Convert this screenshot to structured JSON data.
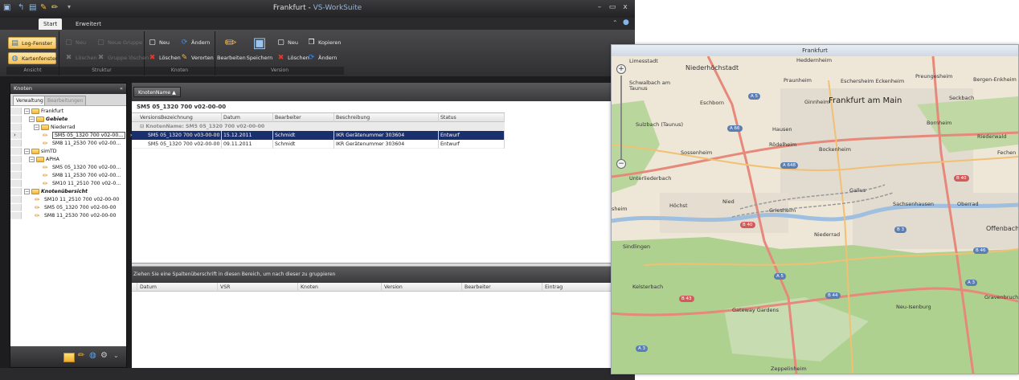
{
  "titlebar": {
    "title_city": "Frankfurt",
    "title_sep": " - ",
    "title_suite": "VS-WorkSuite",
    "min": "–",
    "max": "▭",
    "close": "x"
  },
  "tabs": [
    {
      "label": "Start"
    },
    {
      "label": "Erweitert"
    }
  ],
  "ribbon": {
    "ansicht": {
      "label": "Ansicht",
      "log": "Log-Fenster",
      "karten": "Kartenfenster"
    },
    "struktur": {
      "label": "Struktur",
      "neu": "Neu",
      "neue_gruppe": "Neue Gruppe",
      "loeschen": "Löschen",
      "gruppe_loeschen": "Gruppe löschen"
    },
    "knoten": {
      "label": "Knoten",
      "neu": "Neu",
      "aendern": "Ändern",
      "loeschen": "Löschen",
      "verorten": "Verorten"
    },
    "version": {
      "label": "Version",
      "bearbeiten": "Bearbeiten",
      "speichern": "Speichern",
      "neu": "Neu",
      "loeschen": "Löschen",
      "kopieren": "Kopieren",
      "aendern": "Ändern"
    }
  },
  "leftpanel": {
    "title": "Knoten",
    "collapse": "«",
    "tabs": [
      {
        "label": "Verwaltung"
      },
      {
        "label": "Bearbeitungen"
      }
    ],
    "tree": [
      {
        "label": "Frankfurt"
      },
      {
        "label": "Gebiete"
      },
      {
        "label": "Niederrad"
      },
      {
        "label": "SM5 05_1320 700 v02-00..."
      },
      {
        "label": "SM8 11_2530 700 v02-00..."
      },
      {
        "label": "simTD"
      },
      {
        "label": "APHA"
      },
      {
        "label": "SM5 05_1320 700 v02-00..."
      },
      {
        "label": "SM8 11_2530 700 v02-00..."
      },
      {
        "label": "SM10 11_2510 700 v02-0..."
      },
      {
        "label": "Knotenübersicht"
      },
      {
        "label": "SM10 11_2510 700 v02-00-00"
      },
      {
        "label": "SM5 05_1320 700 v02-00-00"
      },
      {
        "label": "SM8 11_2530 700 v02-00-00"
      }
    ]
  },
  "maingrid": {
    "group_pill": "KnotenName",
    "title": "SM5 05_1320 700 v02-00-00",
    "columns": [
      "VersionsBezeichnung",
      "Datum",
      "Bearbeiter",
      "Beschreibung",
      "Status"
    ],
    "group_row": "KnotenName: SM5 05_1320 700 v02-00-00",
    "rows": [
      {
        "version": "SM5 05_1320 700 v03-00-00",
        "datum": "15.12.2011",
        "bearbeiter": "Schmidt",
        "beschreibung": "IKR Gerätenummer 303604",
        "status": "Entwurf"
      },
      {
        "version": "SM5 05_1320 700 v02-00-00",
        "datum": "09.11.2011",
        "bearbeiter": "Schmidt",
        "beschreibung": "IKR Gerätenummer 303604",
        "status": "Entwurf"
      }
    ]
  },
  "lowergrid": {
    "hint": "Ziehen Sie eine Spaltenüberschrift in diesen Bereich, um nach dieser zu gruppieren",
    "columns": [
      "Datum",
      "VSR",
      "Knoten",
      "Version",
      "Bearbeiter",
      "Eintrag"
    ]
  },
  "map": {
    "title": "Frankfurt",
    "zoom_in": "+",
    "zoom_out": "−",
    "labels": {
      "limesstadt": "Limesstadt",
      "niederhoechstadt": "Niederhöchstadt",
      "heddernheim": "Heddernheim",
      "schwalbach": "Schwalbach am Taunus",
      "praunheim": "Praunheim",
      "eschersheim": "Eschersheim Eckenheim",
      "preungesheim": "Preungesheim",
      "bergen": "Bergen-Enkheim",
      "eschborn": "Eschborn",
      "ginnheim": "Ginnheim",
      "frankfurt": "Frankfurt am Main",
      "seckbach": "Seckbach",
      "sulzbach": "Sulzbach (Taunus)",
      "hausen": "Hausen",
      "bornheim": "Bornheim",
      "riederwald": "Riederwald",
      "roedelheim": "Rödelheim",
      "bockenheim": "Bockenheim",
      "sossenheim": "Sossenheim",
      "fechen": "Fechen",
      "unterliederbach": "Unterliederbach",
      "gallus": "Gallus",
      "sheim": "sheim",
      "nied": "Nied",
      "hoechst": "Höchst",
      "griesheim": "Griesheim",
      "sachsenhausen": "Sachsenhausen",
      "oberrad": "Oberrad",
      "offenbach": "Offenbach a",
      "niederrad": "Niederrad",
      "sindlingen": "Sindlingen",
      "kelsterbach": "Kelsterbach",
      "gateway": "Gateway Gardens",
      "neu_isenburg": "Neu-Isenburg",
      "gravenbruch": "Gravenbruch",
      "zeppelinheim": "Zeppelinheim"
    },
    "shields": {
      "a5_top": "A 5",
      "a66": "A 66",
      "a648": "A 648",
      "b40_left": "B 40",
      "b43_left": "B 43",
      "b44": "B 44",
      "b3": "B 3",
      "b46": "B 46",
      "a3": "A 3",
      "a5_mid": "A 5",
      "b40_right": "B 40",
      "a3_bottom": "A 3"
    },
    "colors": {
      "water": "#a8c4e0",
      "forest": "#a9cf8e",
      "urban": "#e3ddd3",
      "motorway": "#e58a7a",
      "trunk": "#f2c075"
    }
  }
}
